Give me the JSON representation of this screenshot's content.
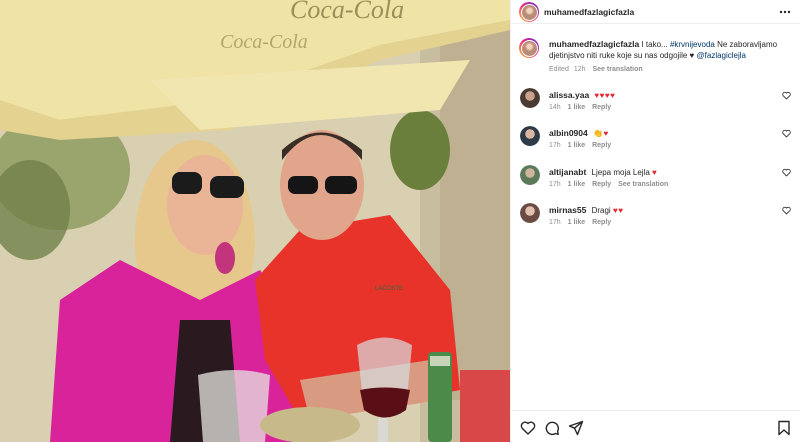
{
  "post": {
    "username": "muhamedfazlagicfazla",
    "caption": {
      "username": "muhamedfazlagicfazla",
      "text_start": "I tako...",
      "hashtag": "#krvnijevoda",
      "text_mid": "Ne zaboravljamo djetinjstvo niti ruke koje su nas odgojile",
      "heart": "♥",
      "mention": "@fazlagiclejla",
      "edited": "Edited",
      "time": "12h",
      "see_translation": "See translation"
    }
  },
  "comments": [
    {
      "username": "alissa.yaa",
      "text": "",
      "emoji": "♥♥♥♥",
      "time": "14h",
      "likes": "1 like",
      "reply": "Reply",
      "see_translation": ""
    },
    {
      "username": "albin0904",
      "text": "",
      "emoji": "👏♥",
      "time": "17h",
      "likes": "1 like",
      "reply": "Reply",
      "see_translation": ""
    },
    {
      "username": "altijanabt",
      "text": "Ljepa moja Lejla",
      "emoji": "♥",
      "time": "17h",
      "likes": "1 like",
      "reply": "Reply",
      "see_translation": "See translation"
    },
    {
      "username": "mirnas55",
      "text": "Dragi",
      "emoji": "♥♥",
      "time": "17h",
      "likes": "1 like",
      "reply": "Reply",
      "see_translation": ""
    }
  ],
  "photo": {
    "umbrella_text": "Coca-Cola",
    "shirt_logo": "LACOSTE"
  },
  "icons": {
    "more": "more-horizontal-icon",
    "heart": "heart-icon",
    "comment": "comment-icon",
    "share": "share-icon",
    "save": "bookmark-icon"
  },
  "colors": {
    "link": "#00376b",
    "heart": "#e3262f",
    "muted": "#8e8e8e"
  }
}
